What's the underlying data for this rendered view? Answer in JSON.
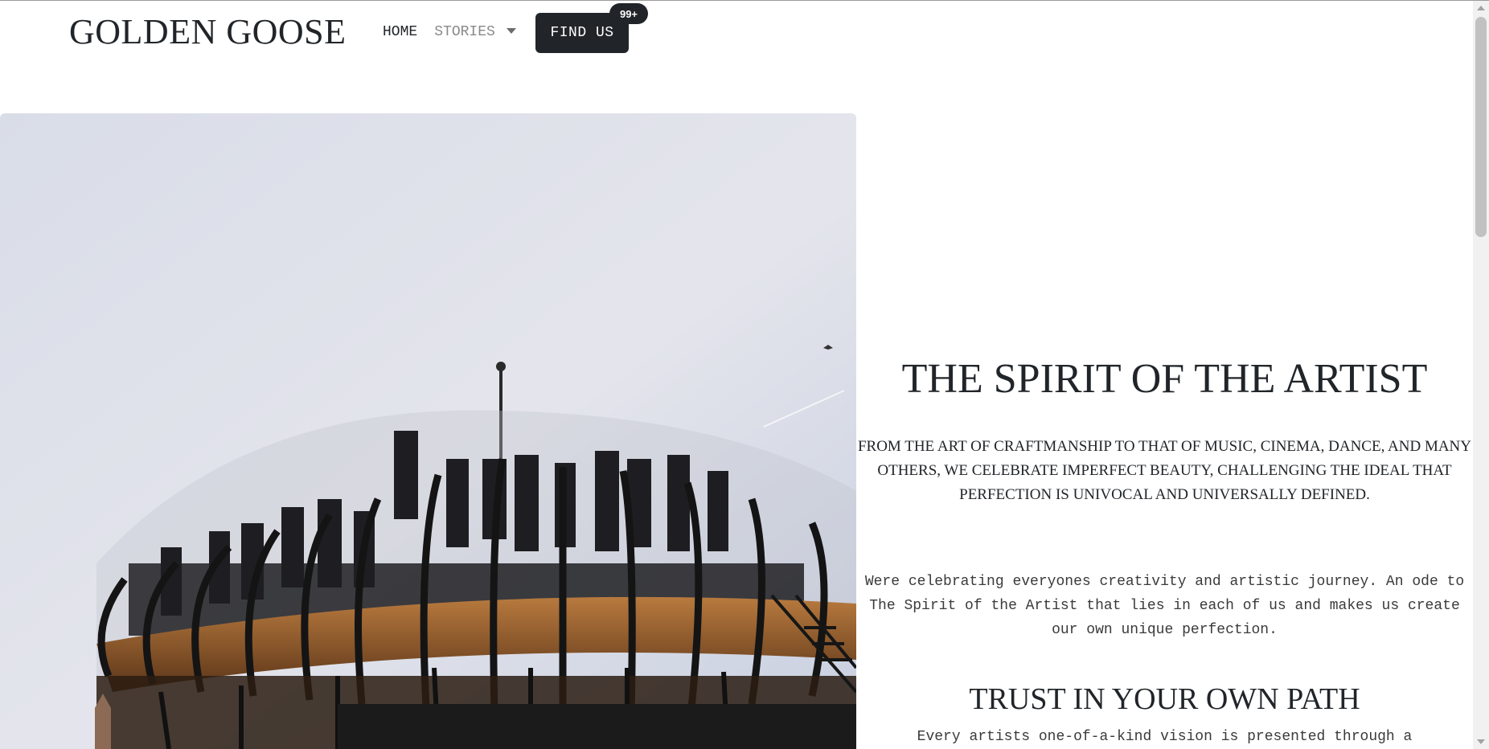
{
  "header": {
    "brand": "GOLDEN GOOSE",
    "nav": {
      "home": "HOME",
      "stories": "STORIES",
      "find_us": "FIND US",
      "badge": "99+"
    }
  },
  "hero": {
    "image_alt": "Group of people on a circular wooden viewing platform with black metal arches against the sky"
  },
  "main": {
    "title": "THE SPIRIT OF THE ARTIST",
    "lead": "FROM THE ART OF CRAFTMANSHIP TO THAT OF MUSIC, CINEMA, DANCE, AND MANY OTHERS, WE CELEBRATE IMPERFECT BEAUTY, CHALLENGING THE IDEAL THAT PERFECTION IS UNIVOCAL AND UNIVERSALLY DEFINED.",
    "paragraph": "Were celebrating everyones creativity and artistic journey. An ode to The Spirit of the Artist that lies in each of us and makes us create our own unique perfection.",
    "subtitle": "TRUST IN YOUR OWN PATH",
    "paragraph2": "Every artists one-of-a-kind vision is presented through a"
  },
  "colors": {
    "text": "#212529",
    "button_bg": "#212529",
    "button_text": "#ffffff",
    "muted": "#8a8a8a"
  },
  "icons": {
    "dropdown": "caret-down-icon"
  }
}
